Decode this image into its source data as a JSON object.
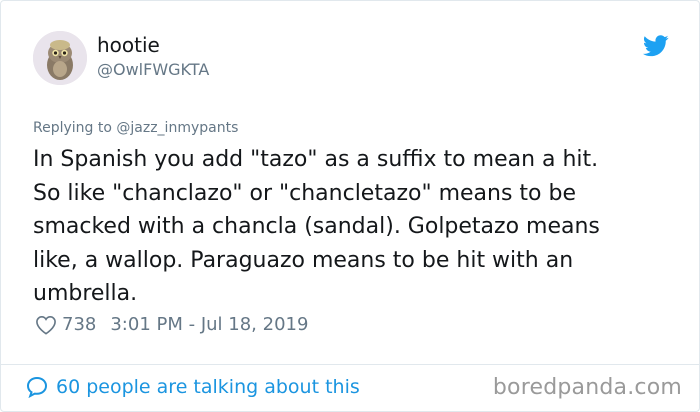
{
  "author": {
    "display_name": "hootie",
    "handle": "@OwlFWGKTA",
    "avatar_icon": "owl-avatar-icon"
  },
  "platform_icon": "twitter-bird-icon",
  "reply": {
    "prefix": "Replying to ",
    "mention": "@jazz_inmypants"
  },
  "tweet": {
    "text": "In Spanish you add \"tazo\" as a suffix to mean a hit.\nSo like \"chanclazo\" or \"chancletazo\" means to be\nsmacked with a chancla (sandal). Golpetazo means\nlike, a wallop. Paraguazo means to be hit with an\numbrella."
  },
  "meta": {
    "like_icon": "heart-icon",
    "likes": "738",
    "timestamp": "3:01 PM - Jul 18, 2019"
  },
  "footer": {
    "icon": "speech-bubble-icon",
    "talking_text": "60 people are talking about this",
    "watermark": "boredpanda.com"
  },
  "colors": {
    "text": "#14171a",
    "secondary": "#657786",
    "accent": "#1b95e0",
    "twitter_blue": "#1da1f2",
    "border": "#e1e8ed"
  }
}
